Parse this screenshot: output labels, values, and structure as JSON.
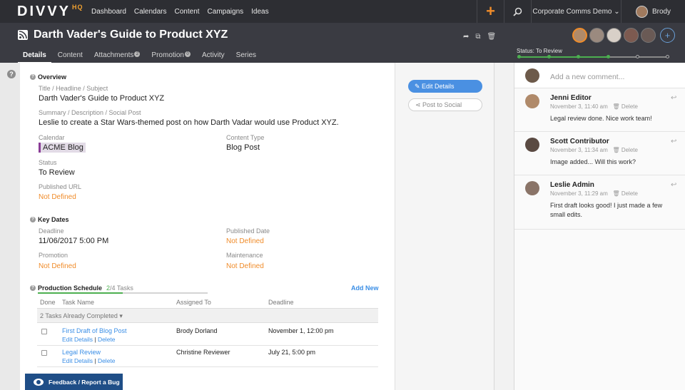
{
  "nav": {
    "logo_main": "DIVVY",
    "logo_hq": "HQ",
    "links": [
      "Dashboard",
      "Calendars",
      "Content",
      "Campaigns",
      "Ideas"
    ],
    "add_icon": "plus-icon",
    "search_icon": "search-icon",
    "workspace": "Corporate Comms Demo ⌄",
    "user": "Brody"
  },
  "header": {
    "title": "Darth Vader's Guide to Product XYZ",
    "icons": [
      "share-icon",
      "copy-icon",
      "trash-icon"
    ],
    "tabs": [
      {
        "label": "Details",
        "badge": ""
      },
      {
        "label": "Content",
        "badge": ""
      },
      {
        "label": "Attachments",
        "badge": "2"
      },
      {
        "label": "Promotion",
        "badge": "0"
      },
      {
        "label": "Activity",
        "badge": ""
      },
      {
        "label": "Series",
        "badge": ""
      }
    ],
    "add_collaborator": "+",
    "status_label": "Status: To Review",
    "status_progress_steps": 4,
    "status_total_steps": 6
  },
  "overview": {
    "section": "Overview",
    "title_label": "Title / Headline / Subject",
    "title_value": "Darth Vader's Guide to Product XYZ",
    "summary_label": "Summary / Description / Social Post",
    "summary_value": "Leslie to create a Star Wars-themed post on how Darth Vadar would use Product XYZ.",
    "calendar_label": "Calendar",
    "calendar_value": "ACME Blog",
    "content_type_label": "Content Type",
    "content_type_value": "Blog Post",
    "status_label": "Status",
    "status_value": "To Review",
    "url_label": "Published URL",
    "url_value": "Not Defined"
  },
  "key_dates": {
    "section": "Key Dates",
    "deadline_label": "Deadline",
    "deadline_value": "11/06/2017 5:00 PM",
    "published_label": "Published Date",
    "published_value": "Not Defined",
    "promotion_label": "Promotion",
    "promotion_value": "Not Defined",
    "maintenance_label": "Maintenance",
    "maintenance_value": "Not Defined"
  },
  "production": {
    "section": "Production Schedule",
    "done": "2",
    "total": "/4 Tasks",
    "progress": 0.5,
    "add_new": "Add New",
    "columns": [
      "Done",
      "Task Name",
      "Assigned To",
      "Deadline"
    ],
    "completed_toggle": "2 Tasks Already Completed ▾",
    "tasks": [
      {
        "name": "First Draft of Blog Post",
        "edit": "Edit Details",
        "delete": "Delete",
        "assignee": "Brody Dorland",
        "deadline": "November 1, 12:00 pm"
      },
      {
        "name": "Legal Review",
        "edit": "Edit Details",
        "delete": "Delete",
        "assignee": "Christine Reviewer",
        "deadline": "July 21, 5:00 pm"
      }
    ]
  },
  "feedback": "Feedback / Report a Bug",
  "actions": {
    "edit": "✎ Edit Details",
    "social": "⋖ Post to Social"
  },
  "comments": {
    "placeholder": "Add a new comment...",
    "items": [
      {
        "author": "Jenni Editor",
        "time": "November 3, 11:40 am",
        "delete": "🗑 Delete",
        "text": "Legal review done. Nice work team!",
        "color": "#b08a6a"
      },
      {
        "author": "Scott Contributor",
        "time": "November 3, 11:34 am",
        "delete": "🗑 Delete",
        "text": "Image added... Will this work?",
        "color": "#5a4a42"
      },
      {
        "author": "Leslie Admin",
        "time": "November 3, 11:29 am",
        "delete": "🗑 Delete",
        "text": "First draft looks good! I just made a few small edits.",
        "color": "#8a7468"
      }
    ]
  }
}
